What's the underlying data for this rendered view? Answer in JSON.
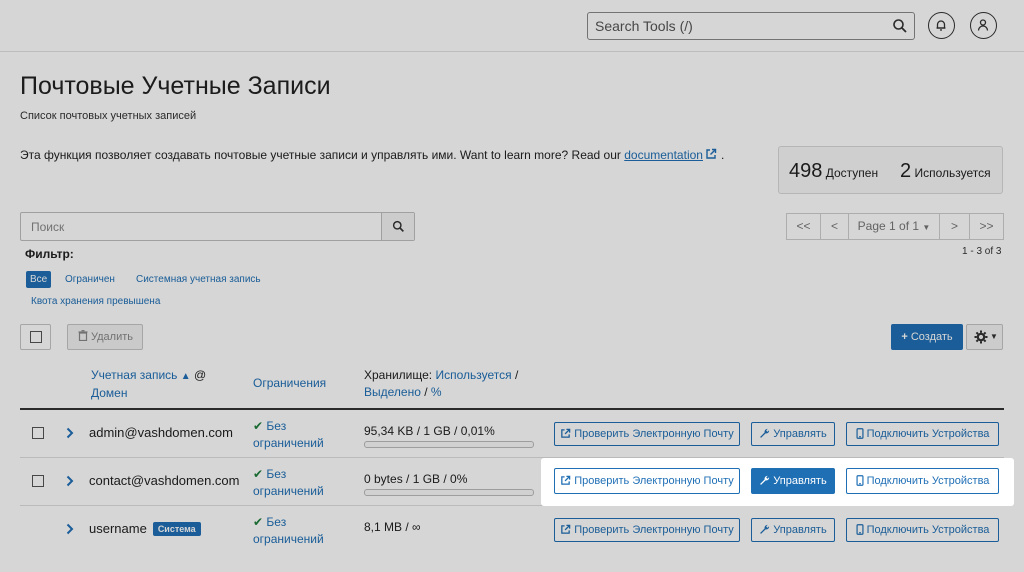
{
  "header": {
    "search_placeholder": "Search Tools (/)"
  },
  "page": {
    "title": "Почтовые Учетные Записи",
    "subtitle": "Список почтовых учетных записей",
    "intro_text": "Эта функция позволяет создавать почтовые учетные записи и управлять ими. Want to learn more? Read our ",
    "intro_link": "documentation",
    "intro_end": "."
  },
  "stats": {
    "available_count": "498",
    "available_label": "Доступен",
    "used_count": "2",
    "used_label": "Используется"
  },
  "search": {
    "placeholder": "Поиск"
  },
  "pagination": {
    "first": "<<",
    "prev": "<",
    "page_label": "Page 1 of 1",
    "next": ">",
    "last": ">>",
    "count": "1 - 3 of 3"
  },
  "filter": {
    "label": "Фильтр:",
    "options": [
      "Все",
      "Ограничен",
      "Системная учетная запись",
      "Квота хранения превышена"
    ],
    "active": "Все"
  },
  "toolbar": {
    "delete_label": "Удалить",
    "create_label": "Создать"
  },
  "table": {
    "col_account_1": "Учетная запись",
    "col_account_at": "@",
    "col_account_2": "Домен",
    "col_limits": "Ограничения",
    "col_storage_prefix": "Хранилище: ",
    "col_storage_used": "Используется",
    "col_storage_sep": " /",
    "col_storage_alloc": "Выделено",
    "col_storage_sep2": " / ",
    "col_storage_pct": "%",
    "rows": [
      {
        "account": "admin@vashdomen.com",
        "badge": "",
        "limit_1": "Без",
        "limit_2": "ограничений",
        "storage": "95,34 KB / 1 GB / 0,01%",
        "usage": 0.0001
      },
      {
        "account": "contact@vashdomen.com",
        "badge": "",
        "limit_1": "Без",
        "limit_2": "ограничений",
        "storage": "0 bytes / 1 GB / 0%",
        "usage": 0
      },
      {
        "account": "username",
        "badge": "Система",
        "limit_1": "Без",
        "limit_2": "ограничений",
        "storage": "8,1 MB / ∞",
        "usage": null
      }
    ],
    "actions": {
      "check_email": "Проверить Электронную Почту",
      "manage": "Управлять",
      "connect_devices": "Подключить Устройства"
    }
  },
  "colors": {
    "accent": "#1f6fb5",
    "success": "#1d7f3a"
  }
}
